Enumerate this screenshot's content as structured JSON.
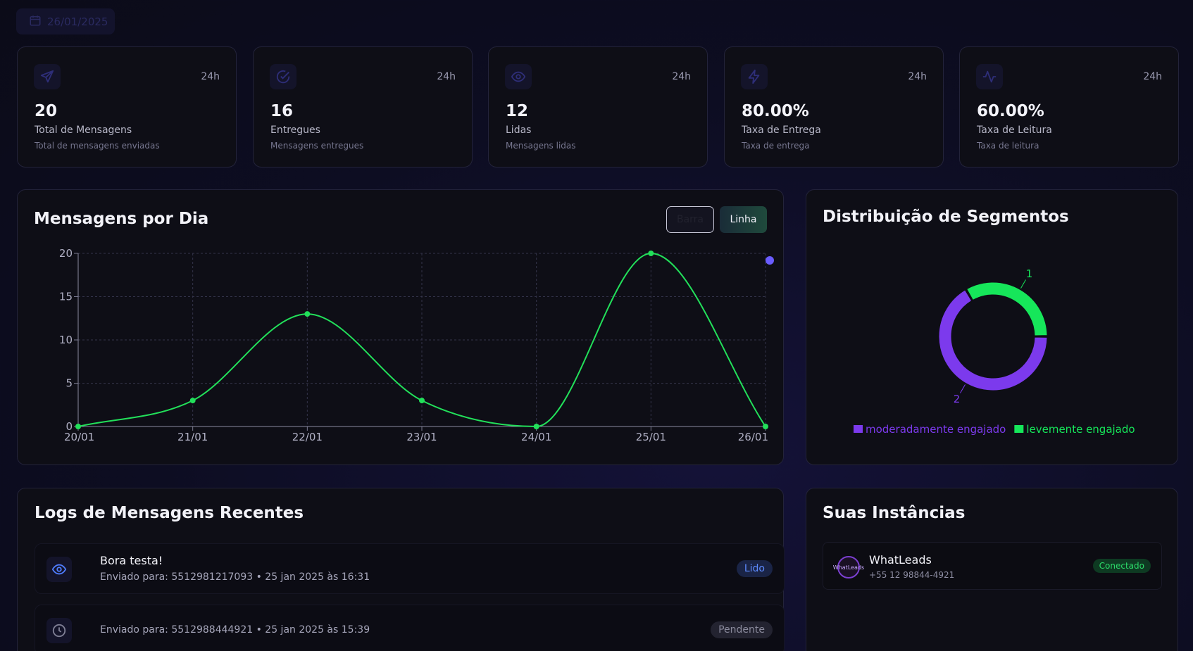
{
  "date_filter": {
    "value": "26/01/2025"
  },
  "stats": [
    {
      "icon": "send-icon",
      "period": "24h",
      "value": "20",
      "label": "Total de Mensagens",
      "desc": "Total de mensagens enviadas"
    },
    {
      "icon": "check-circle-icon",
      "period": "24h",
      "value": "16",
      "label": "Entregues",
      "desc": "Mensagens entregues"
    },
    {
      "icon": "eye-icon",
      "period": "24h",
      "value": "12",
      "label": "Lidas",
      "desc": "Mensagens lidas"
    },
    {
      "icon": "zap-icon",
      "period": "24h",
      "value": "80.00%",
      "label": "Taxa de Entrega",
      "desc": "Taxa de entrega"
    },
    {
      "icon": "activity-icon",
      "period": "24h",
      "value": "60.00%",
      "label": "Taxa de Leitura",
      "desc": "Taxa de leitura"
    }
  ],
  "messages_chart": {
    "title": "Mensagens por Dia",
    "toggle": {
      "bar_label": "Barra",
      "line_label": "Linha"
    }
  },
  "segments_chart": {
    "title": "Distribuição de Segmentos"
  },
  "logs": {
    "title": "Logs de Mensagens Recentes",
    "items": [
      {
        "icon": "eye-icon",
        "message": "Bora testa!",
        "meta": "Enviado para: 5512981217093  •  25 jan 2025 às 16:31",
        "status": "Lido"
      },
      {
        "icon": "clock-icon",
        "message": "",
        "meta": "Enviado para: 5512988444921  •  25 jan 2025 às 15:39",
        "status": "Pendente"
      }
    ]
  },
  "instances": {
    "title": "Suas Instâncias",
    "items": [
      {
        "name": "WhatLeads",
        "phone": "+55 12 98844-4921",
        "status": "Conectado",
        "avatar_text": "WhatLeads"
      }
    ]
  },
  "colors": {
    "accent_green": "#22e05a",
    "accent_purple": "#7c3aed",
    "read_blue": "#5e8bff"
  },
  "chart_data": [
    {
      "type": "line",
      "title": "Mensagens por Dia",
      "x": [
        "20/01",
        "21/01",
        "22/01",
        "23/01",
        "24/01",
        "25/01",
        "26/01"
      ],
      "series": [
        {
          "values": [
            0,
            3,
            13,
            3,
            0,
            20,
            0
          ],
          "color": "#22e05a"
        }
      ],
      "yticks": [
        0,
        5,
        10,
        15,
        20
      ],
      "ylim": [
        0,
        20
      ],
      "grid": true
    },
    {
      "type": "pie",
      "title": "Distribuição de Segmentos",
      "labels": [
        "moderadamente engajado",
        "levemente engajado"
      ],
      "values": [
        2,
        1
      ],
      "colors": [
        "#7c3aed",
        "#16e65a"
      ],
      "donut": true,
      "legend": "bottom"
    }
  ]
}
